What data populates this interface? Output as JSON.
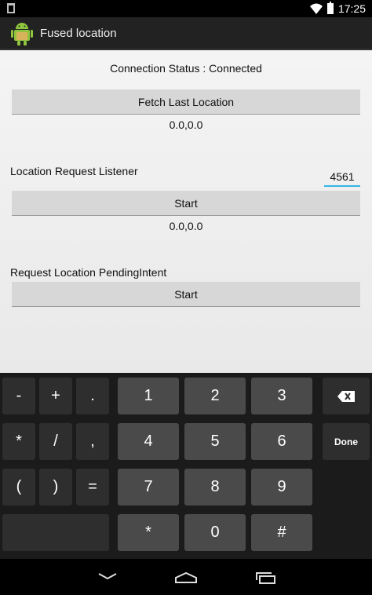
{
  "status_bar": {
    "time": "17:25"
  },
  "action_bar": {
    "title": "Fused location",
    "icon": "android-icon"
  },
  "content": {
    "connection_status": "Connection Status : Connected",
    "fetch_button": "Fetch Last Location",
    "last_location": "0.0,0.0",
    "listener_label": "Location Request Listener",
    "interval_value": "4561",
    "listener_start_button": "Start",
    "listener_location": "0.0,0.0",
    "pending_label": "Request Location PendingIntent",
    "pending_start_button": "Start"
  },
  "keyboard": {
    "row1": [
      "-",
      "+",
      ".",
      "1",
      "2",
      "3"
    ],
    "row2": [
      "*",
      "/",
      ",",
      "4",
      "5",
      "6",
      "Done"
    ],
    "row3": [
      "(",
      ")",
      "=",
      "7",
      "8",
      "9"
    ],
    "row4": [
      "*",
      "0",
      "#"
    ],
    "backspace_icon": "backspace-icon"
  },
  "nav_bar": {
    "icons": [
      "back-icon",
      "home-icon",
      "recents-icon"
    ]
  }
}
